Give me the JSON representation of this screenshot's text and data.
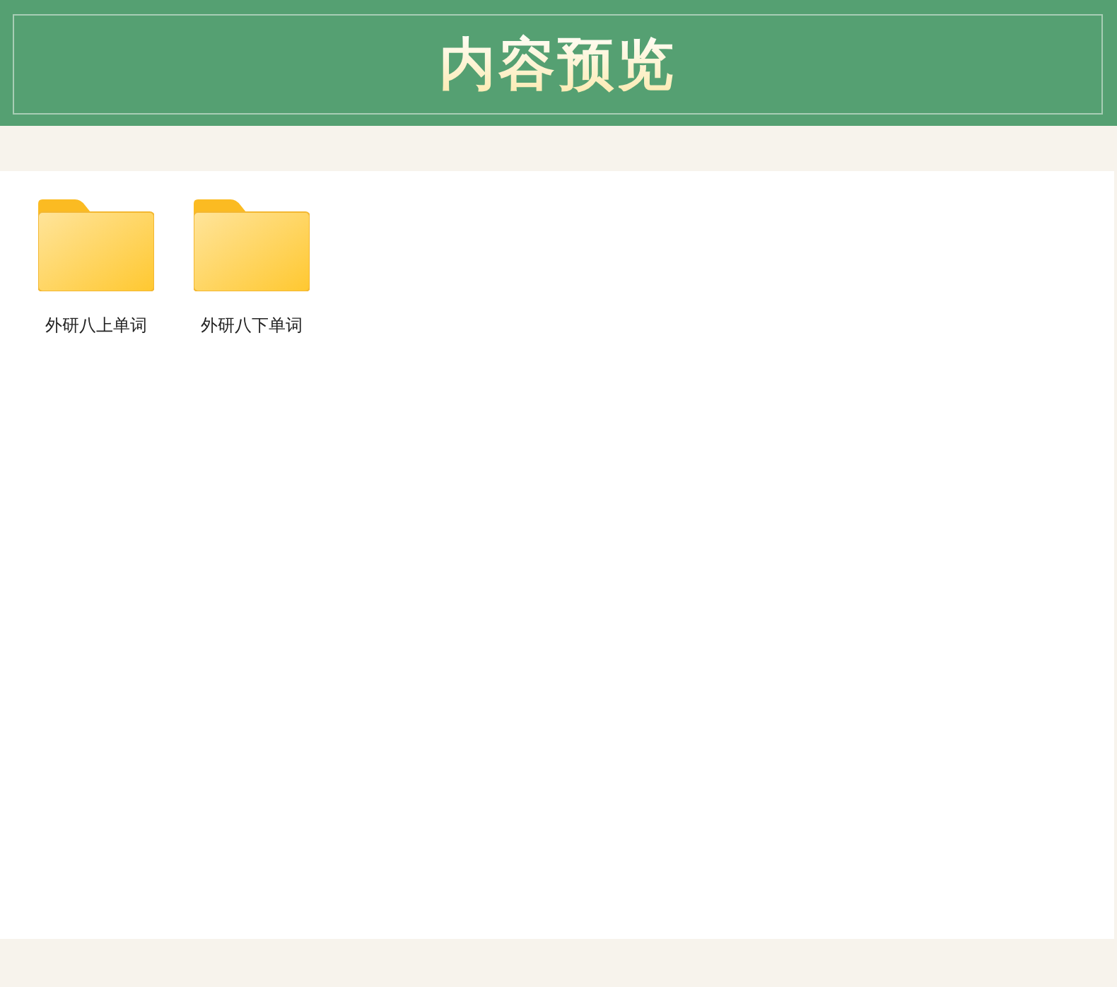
{
  "header": {
    "title": "内容预览"
  },
  "folders": [
    {
      "name": "外研八上单词"
    },
    {
      "name": "外研八下单词"
    }
  ]
}
